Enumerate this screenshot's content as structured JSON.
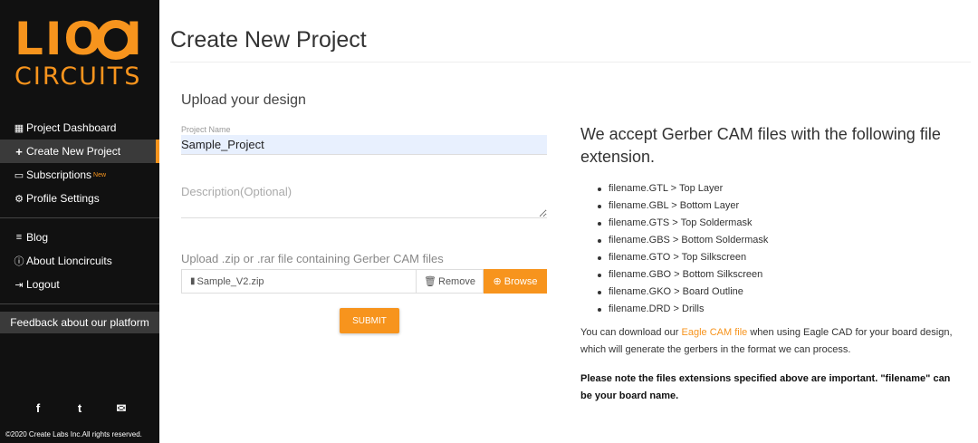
{
  "logo": {
    "top": "LION",
    "bottom": "CIRCUITS"
  },
  "sidebar": {
    "items": [
      {
        "label": "Project Dashboard",
        "icon": "grid-icon"
      },
      {
        "label": "Create New Project",
        "icon": "plus-icon"
      },
      {
        "label": "Subscriptions",
        "badge": "New",
        "icon": "monitor-icon"
      },
      {
        "label": "Profile Settings",
        "icon": "gear-icon"
      }
    ],
    "secondary": [
      {
        "label": "Blog",
        "icon": "list-icon"
      },
      {
        "label": "About Lioncircuits",
        "icon": "info-icon"
      },
      {
        "label": "Logout",
        "icon": "logout-icon"
      }
    ],
    "feedback": "Feedback about our platform",
    "social": {
      "facebook": "f",
      "twitter": "t",
      "email": "✉"
    },
    "copyright": "©2020 Create Labs Inc.All rights reserved."
  },
  "main": {
    "title": "Create New Project",
    "form": {
      "section_title": "Upload your design",
      "project_name_label": "Project Name",
      "project_name_value": "Sample_Project",
      "description_placeholder": "Description(Optional)",
      "upload_label": "Upload .zip or .rar file containing Gerber CAM files",
      "file_name": "Sample_V2.zip",
      "remove_label": "Remove",
      "browse_label": "Browse",
      "submit_label": "SUBMIT"
    }
  },
  "info": {
    "heading": "We accept Gerber CAM files with the following file extension.",
    "extensions": [
      "filename.GTL > Top Layer",
      "filename.GBL > Bottom Layer",
      "filename.GTS > Top Soldermask",
      "filename.GBS > Bottom Soldermask",
      "filename.GTO > Top Silkscreen",
      "filename.GBO > Bottom Silkscreen",
      "filename.GKO > Board Outline",
      "filename.DRD > Drills"
    ],
    "download_prefix": "You can download our ",
    "download_link": "Eagle CAM file",
    "download_suffix": " when using Eagle CAD for your board design, which will generate the gerbers in the format we can process.",
    "note": "Please note the files extensions specified above are important. \"filename\" can be your board name."
  },
  "colors": {
    "accent": "#f7941d",
    "sidebar_bg": "#111111",
    "active_bg": "#3a3a3a"
  }
}
